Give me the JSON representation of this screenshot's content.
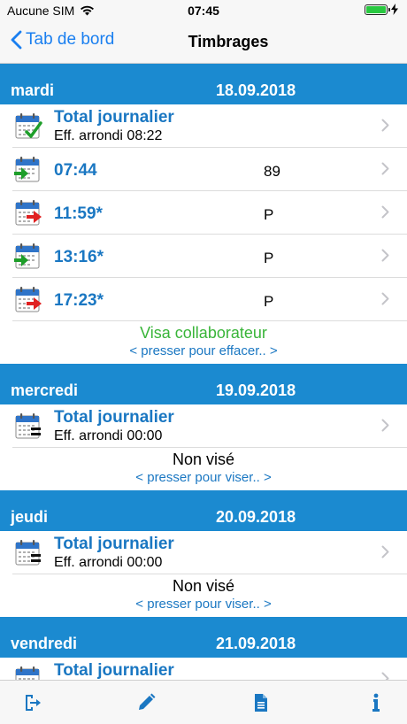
{
  "status": {
    "carrier": "Aucune SIM",
    "time": "07:45",
    "battery_level": 1.0
  },
  "nav": {
    "back_label": "Tab de bord",
    "title": "Timbrages"
  },
  "days": [
    {
      "name": "mardi",
      "date": "18.09.2018",
      "total": {
        "title": "Total journalier",
        "subtitle": "Eff. arrondi 08:22",
        "icon": "calendar-check-icon"
      },
      "stamps": [
        {
          "time": "07:44",
          "code": "89",
          "direction": "in"
        },
        {
          "time": "11:59*",
          "code": "P",
          "direction": "out"
        },
        {
          "time": "13:16*",
          "code": "P",
          "direction": "in"
        },
        {
          "time": "17:23*",
          "code": "P",
          "direction": "out"
        }
      ],
      "visa": {
        "status": "Visa collaborateur",
        "action": "< presser pour effacer.. >",
        "status_color": "#39b539"
      }
    },
    {
      "name": "mercredi",
      "date": "19.09.2018",
      "total": {
        "title": "Total journalier",
        "subtitle": "Eff. arrondi 00:00",
        "icon": "calendar-equal-icon"
      },
      "stamps": [],
      "visa": {
        "status": "Non visé",
        "action": "< presser pour viser.. >",
        "status_color": "#000000"
      }
    },
    {
      "name": "jeudi",
      "date": "20.09.2018",
      "total": {
        "title": "Total journalier",
        "subtitle": "Eff. arrondi 00:00",
        "icon": "calendar-equal-icon"
      },
      "stamps": [],
      "visa": {
        "status": "Non visé",
        "action": "< presser pour viser.. >",
        "status_color": "#000000"
      }
    },
    {
      "name": "vendredi",
      "date": "21.09.2018",
      "total": {
        "title": "Total journalier",
        "subtitle": "",
        "icon": "calendar-equal-icon"
      },
      "stamps": [],
      "visa": null
    }
  ],
  "tabbar": {
    "items": [
      "logout-icon",
      "edit-icon",
      "document-icon",
      "info-icon"
    ]
  },
  "colors": {
    "accent": "#1a77c2",
    "header_bg": "#1b8ad0",
    "visa_green": "#39b539"
  }
}
